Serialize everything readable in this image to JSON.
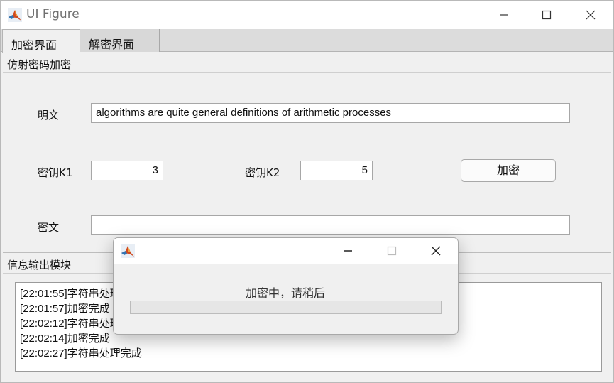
{
  "window": {
    "title": "UI Figure"
  },
  "tabs": [
    {
      "label": "加密界面"
    },
    {
      "label": "解密界面"
    }
  ],
  "encrypt_panel": {
    "title": "仿射密码加密",
    "plaintext_label": "明文",
    "plaintext_value": "algorithms are quite general definitions of arithmetic processes",
    "k1_label": "密钥K1",
    "k1_value": "3",
    "k2_label": "密钥K2",
    "k2_value": "5",
    "encrypt_button": "加密",
    "ciphertext_label": "密文",
    "ciphertext_value": ""
  },
  "log_panel": {
    "title": "信息输出模块",
    "lines": [
      "[22:01:55]字符串处理完成",
      "[22:01:57]加密完成",
      "[22:02:12]字符串处理完成",
      "[22:02:14]加密完成",
      "[22:02:27]字符串处理完成"
    ]
  },
  "dialog": {
    "message": "加密中，请稍后",
    "progress": 0
  },
  "icons": {
    "app": "matlab-icon",
    "minimize": "minimize-icon",
    "maximize": "maximize-icon",
    "close": "close-icon"
  }
}
